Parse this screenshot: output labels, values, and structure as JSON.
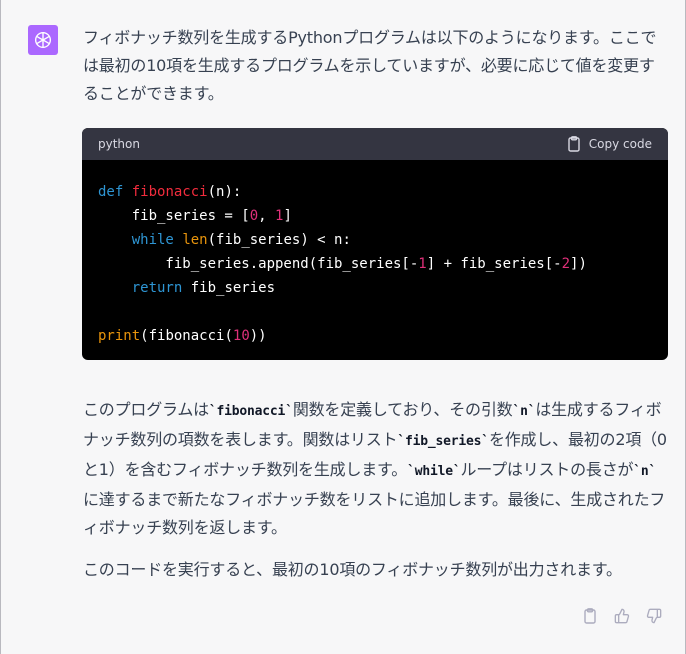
{
  "message": {
    "paragraph1": "フィボナッチ数列を生成するPythonプログラムは以下のようになります。ここでは最初の10項を生成するプログラムを示していますが、必要に応じて値を変更することができます。",
    "paragraph2_parts": [
      "このプログラムは",
      "`fibonacci`",
      "関数を定義しており、その引数",
      "`n`",
      "は生成するフィボナッチ数列の項数を表します。関数はリスト",
      "`fib_series`",
      "を作成し、最初の2項（0と1）を含むフィボナッチ数列を生成します。",
      "`while`",
      "ループはリストの長さが",
      "`n`",
      "に達するまで新たなフィボナッチ数をリストに追加します。最後に、生成されたフィボナッチ数列を返します。"
    ],
    "paragraph3": "このコードを実行すると、最初の10項のフィボナッチ数列が出力されます。"
  },
  "code_block": {
    "language": "python",
    "copy_label": "Copy code",
    "tokens": {
      "def": "def",
      "fname": "fibonacci",
      "sig": "(n):",
      "line2a": "    fib_series = [",
      "zero": "0",
      "comma": ", ",
      "one": "1",
      "close": "]",
      "indent": "    ",
      "while": "while",
      "sp": " ",
      "len": "len",
      "line3rest": "(fib_series) < n:",
      "line4a": "        fib_series.append(fib_series[-",
      "m1": "1",
      "line4b": "] + fib_series[-",
      "m2": "2",
      "line4c": "])",
      "return": "return",
      "retval": " fib_series",
      "print": "print",
      "p1": "(",
      "p2": "fibonacci",
      "p3": "(",
      "ten": "10",
      "p4": "))"
    }
  },
  "icons": {
    "avatar": "openai-logo-icon",
    "copy": "clipboard-icon",
    "actions": [
      "clipboard-icon",
      "thumbs-up-icon",
      "thumbs-down-icon"
    ]
  },
  "colors": {
    "avatar_bg": "#ab68ff",
    "code_bg": "#000000",
    "code_header_bg": "#343541"
  }
}
